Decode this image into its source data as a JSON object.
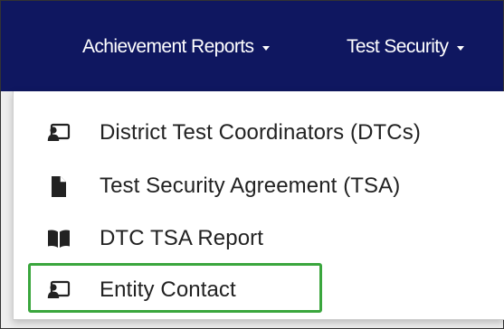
{
  "navbar": {
    "background_color": "#0f1760",
    "items": [
      {
        "label": "Achievement Reports",
        "icon": "caret-down-icon"
      },
      {
        "label": "Test Security",
        "icon": "caret-down-icon"
      }
    ]
  },
  "dropdown": {
    "items": [
      {
        "label": "District Test Coordinators (DTCs)",
        "icon": "contact-card-icon"
      },
      {
        "label": "Test Security Agreement (TSA)",
        "icon": "document-icon"
      },
      {
        "label": "DTC TSA Report",
        "icon": "open-book-icon"
      },
      {
        "label": "Entity Contact",
        "icon": "contact-card-icon",
        "highlighted": true
      }
    ],
    "highlight_color": "#3aa63d"
  }
}
